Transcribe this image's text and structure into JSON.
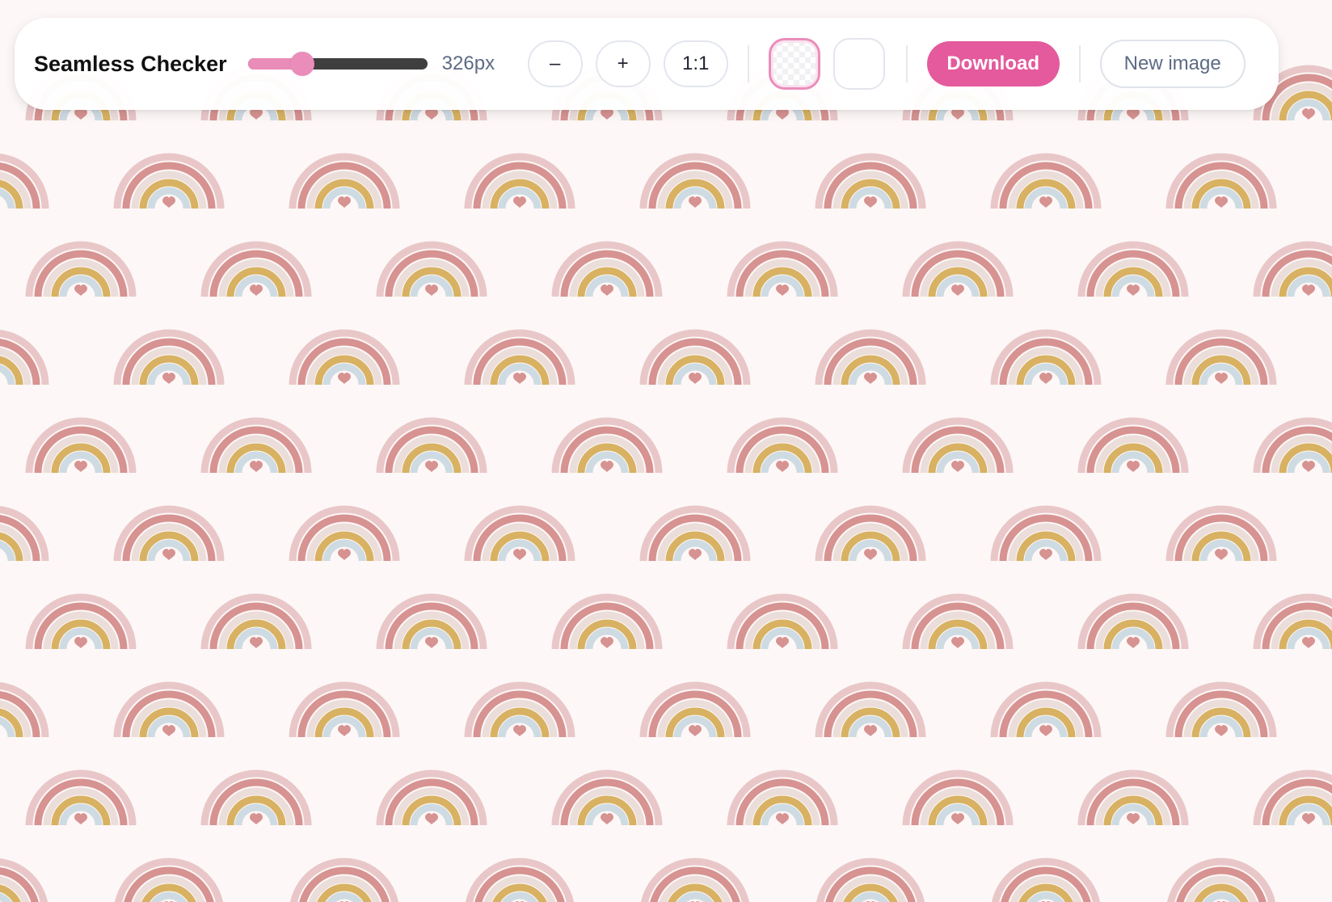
{
  "app": {
    "title": "Seamless Checker"
  },
  "toolbar": {
    "tile_size": {
      "value": 326,
      "min": 64,
      "max": 1024,
      "readout": "326px"
    },
    "zoom_out_label": "–",
    "zoom_in_label": "+",
    "actual_size_label": "1:1",
    "background_options": [
      {
        "name": "checkerboard",
        "selected": true
      },
      {
        "name": "white",
        "selected": false
      }
    ],
    "download_label": "Download",
    "new_image_label": "New image"
  },
  "pattern": {
    "motif": "rainbow-with-heart",
    "background_color": "#fdf8f7",
    "colors": {
      "outer_arc": "#e9c7c9",
      "rose_arc": "#d69391",
      "beige_arc": "#ebddd9",
      "mustard_arc": "#d8b262",
      "blue_arc": "#cfdbe2",
      "heart": "#d69391"
    }
  },
  "colors": {
    "accent": "#e45a9c",
    "slider_fill": "#e98cb8",
    "slider_track": "#3f3f3f",
    "muted_text": "#5d6b84"
  }
}
